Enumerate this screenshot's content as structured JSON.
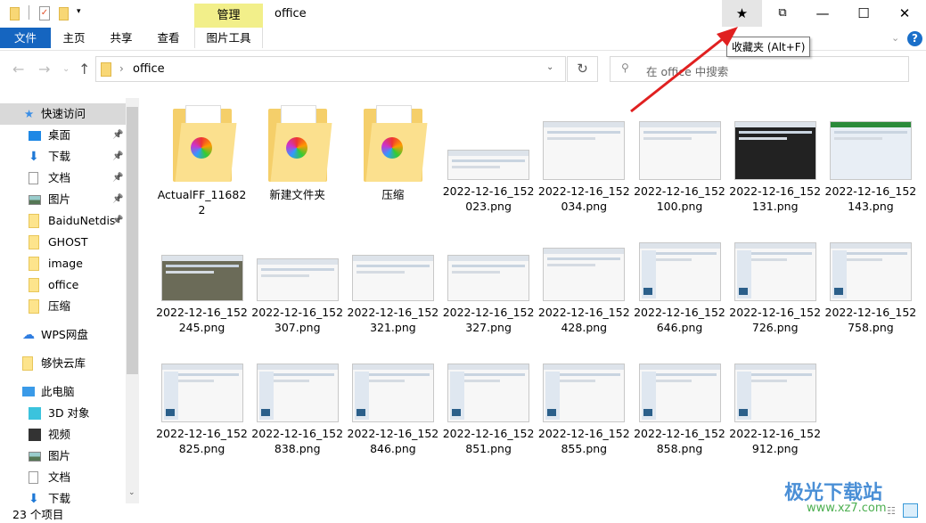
{
  "window": {
    "title": "office",
    "context_tab": "管理",
    "colors": {
      "accent": "#1565c0",
      "context": "#f2ef8a",
      "arrow": "#e02020"
    }
  },
  "ribbon": {
    "tabs": [
      "文件",
      "主页",
      "共享",
      "查看",
      "图片工具"
    ]
  },
  "titlebar_buttons": {
    "favorites": "★",
    "history": "history-icon",
    "minimize": "—",
    "maximize": "☐",
    "close": "✕"
  },
  "tooltip": "收藏夹 (Alt+F)",
  "address": {
    "path": "office"
  },
  "search": {
    "placeholder": "在 office 中搜索"
  },
  "sidebar": {
    "quick_access": "快速访问",
    "items": [
      {
        "label": "桌面",
        "icon": "desktop-icon",
        "pinned": true
      },
      {
        "label": "下载",
        "icon": "download-icon",
        "pinned": true
      },
      {
        "label": "文档",
        "icon": "document-icon",
        "pinned": true
      },
      {
        "label": "图片",
        "icon": "picture-icon",
        "pinned": true
      },
      {
        "label": "BaiduNetdis",
        "icon": "folder-icon",
        "pinned": true
      },
      {
        "label": "GHOST",
        "icon": "folder-icon",
        "pinned": false
      },
      {
        "label": "image",
        "icon": "folder-icon",
        "pinned": false
      },
      {
        "label": "office",
        "icon": "folder-icon",
        "pinned": false
      },
      {
        "label": "压缩",
        "icon": "folder-icon",
        "pinned": false
      }
    ],
    "wps": "WPS网盘",
    "cloud": "够快云库",
    "pc": "此电脑",
    "pc_items": [
      {
        "label": "3D 对象",
        "icon": "3d-objects-icon"
      },
      {
        "label": "视频",
        "icon": "video-icon"
      },
      {
        "label": "图片",
        "icon": "picture-icon"
      },
      {
        "label": "文档",
        "icon": "document-icon"
      },
      {
        "label": "下载",
        "icon": "download-icon"
      }
    ]
  },
  "files": [
    {
      "name": "ActualFF_116822",
      "type": "folder"
    },
    {
      "name": "新建文件夹",
      "type": "folder"
    },
    {
      "name": "压缩",
      "type": "folder"
    },
    {
      "name": "2022-12-16_152023.png",
      "type": "image"
    },
    {
      "name": "2022-12-16_152034.png",
      "type": "image"
    },
    {
      "name": "2022-12-16_152100.png",
      "type": "image"
    },
    {
      "name": "2022-12-16_152131.png",
      "type": "image"
    },
    {
      "name": "2022-12-16_152143.png",
      "type": "image"
    },
    {
      "name": "2022-12-16_152245.png",
      "type": "image"
    },
    {
      "name": "2022-12-16_152307.png",
      "type": "image"
    },
    {
      "name": "2022-12-16_152321.png",
      "type": "image"
    },
    {
      "name": "2022-12-16_152327.png",
      "type": "image"
    },
    {
      "name": "2022-12-16_152428.png",
      "type": "image"
    },
    {
      "name": "2022-12-16_152646.png",
      "type": "image"
    },
    {
      "name": "2022-12-16_152726.png",
      "type": "image"
    },
    {
      "name": "2022-12-16_152758.png",
      "type": "image"
    },
    {
      "name": "2022-12-16_152825.png",
      "type": "image"
    },
    {
      "name": "2022-12-16_152838.png",
      "type": "image"
    },
    {
      "name": "2022-12-16_152846.png",
      "type": "image"
    },
    {
      "name": "2022-12-16_152851.png",
      "type": "image"
    },
    {
      "name": "2022-12-16_152855.png",
      "type": "image"
    },
    {
      "name": "2022-12-16_152858.png",
      "type": "image"
    },
    {
      "name": "2022-12-16_152912.png",
      "type": "image"
    }
  ],
  "status": {
    "count": "23 个项目"
  },
  "watermark": {
    "text": "极光下载站",
    "url": "www.xz7.com"
  }
}
